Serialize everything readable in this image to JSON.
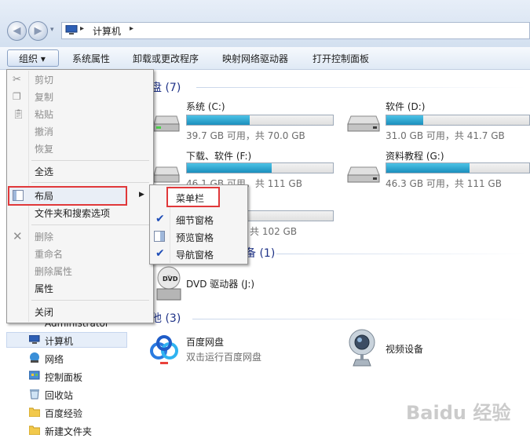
{
  "address": {
    "crumb": "计算机",
    "sep": "▸"
  },
  "toolbar": {
    "organize": "组织 ▾",
    "items": [
      "系统属性",
      "卸载或更改程序",
      "映射网络驱动器",
      "打开控制面板"
    ]
  },
  "groups": {
    "hard_disks": "硬盘 (7)",
    "removable": "备 (1)",
    "other": "其他 (3)"
  },
  "drives": [
    {
      "name": "系统 (C:)",
      "free": "39.7 GB 可用，共 70.0 GB",
      "used": 0.43
    },
    {
      "name": "软件 (D:)",
      "free": "31.0 GB 可用，共 41.7 GB",
      "used": 0.26
    },
    {
      "name": "下载、软件 (F:)",
      "free": "46.1 GB 可用，共 111 GB",
      "used": 0.58
    },
    {
      "name": "资料教程 (G:)",
      "free": "46.3 GB 可用，共 111 GB",
      "used": 0.58
    },
    {
      "name": "",
      "free": "共 102 GB",
      "used": 0.0
    }
  ],
  "dvd": {
    "name": "DVD 驱动器 (J:)",
    "label": "DVD"
  },
  "others": [
    {
      "name": "百度网盘",
      "sub": "双击运行百度网盘"
    },
    {
      "name": "视频设备",
      "sub": ""
    }
  ],
  "nav": [
    "Administrator",
    "计算机",
    "网络",
    "控制面板",
    "回收站",
    "百度经验",
    "新建文件夹"
  ],
  "menu": {
    "cut": "剪切",
    "copy": "复制",
    "paste": "粘贴",
    "undo": "撤消",
    "redo": "恢复",
    "select_all": "全选",
    "layout": "布局",
    "folder_options": "文件夹和搜索选项",
    "delete": "删除",
    "rename": "重命名",
    "remove_props": "删除属性",
    "properties": "属性",
    "close": "关闭"
  },
  "submenu": {
    "menubar": "菜单栏",
    "details": "细节窗格",
    "preview": "预览窗格",
    "navigation": "导航窗格"
  },
  "watermark": "Baidu 经验"
}
